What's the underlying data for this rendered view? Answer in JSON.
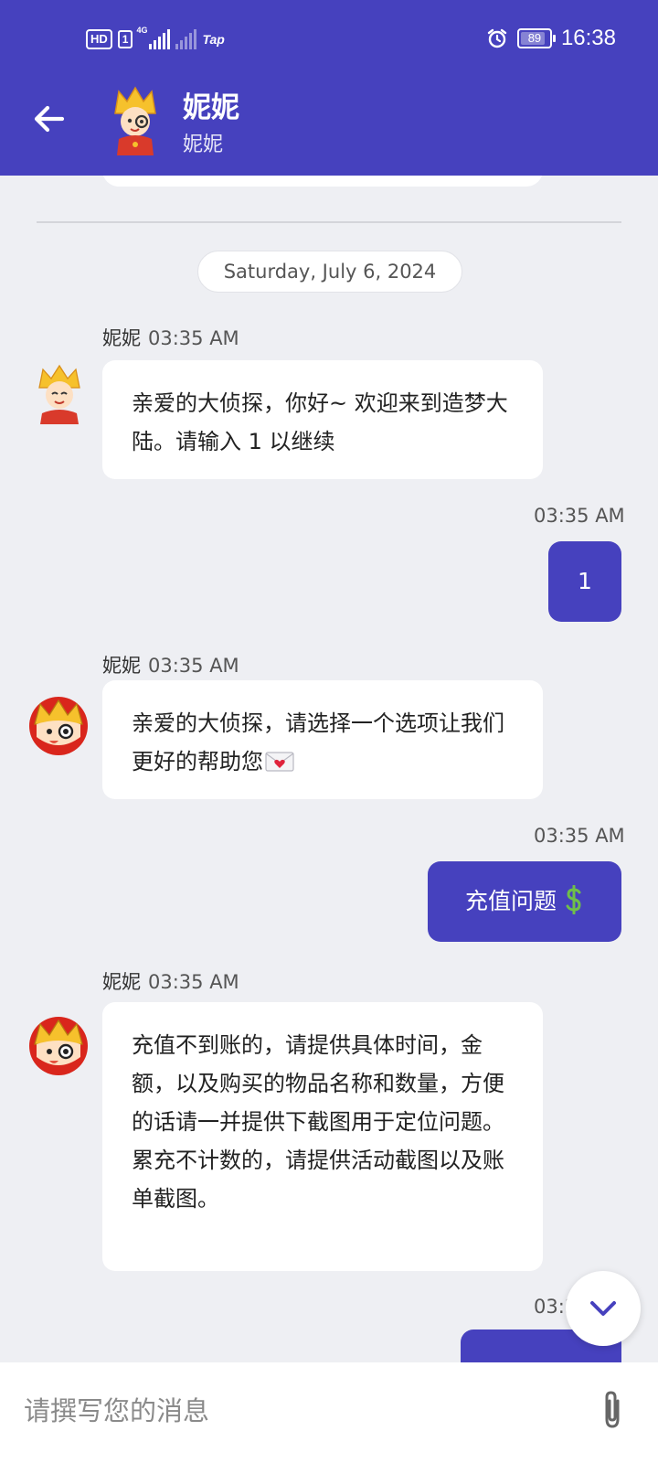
{
  "status_bar": {
    "hd": "HD",
    "sim": "1",
    "network": "4G",
    "carrier_tag": "Tap",
    "battery": "89",
    "battery_level": 0.89,
    "time": "16:38"
  },
  "header": {
    "title": "妮妮",
    "subtitle": "妮妮",
    "background_color": "#4641be"
  },
  "chat": {
    "date_separator": "Saturday, July 6, 2024",
    "messages": [
      {
        "from": "agent",
        "sender": "妮妮",
        "time": "03:35 AM",
        "text": "亲爱的大侦探，你好~ 欢迎来到造梦大陆。请输入 1 以继续"
      },
      {
        "from": "user",
        "time": "03:35 AM",
        "text": "1"
      },
      {
        "from": "agent",
        "sender": "妮妮",
        "time": "03:35 AM",
        "text": "亲爱的大侦探，请选择一个选项让我们更好的帮助您"
      },
      {
        "from": "user",
        "time": "03:35 AM",
        "text": "充值问题"
      },
      {
        "from": "agent",
        "sender": "妮妮",
        "time": "03:35 AM",
        "text": "充值不到账的，请提供具体时间，金额，以及购买的物品名称和数量，方便的话请一并提供下截图用于定位问题。累充不计数的，请提供活动截图以及账单截图。"
      },
      {
        "from": "user",
        "time": "03:3"
      }
    ]
  },
  "composer": {
    "placeholder": "请撰写您的消息"
  },
  "colors": {
    "accent": "#4641be",
    "chat_background": "#eeeff3",
    "bubble_background": "#ffffff",
    "dollar": "#6fbf4a"
  },
  "icons": {
    "back": "arrow-left-icon",
    "attach": "paperclip-icon",
    "scroll_down": "chevron-down-icon",
    "envelope": "envelope-heart-icon",
    "dollar": "dollar-sign-icon"
  }
}
